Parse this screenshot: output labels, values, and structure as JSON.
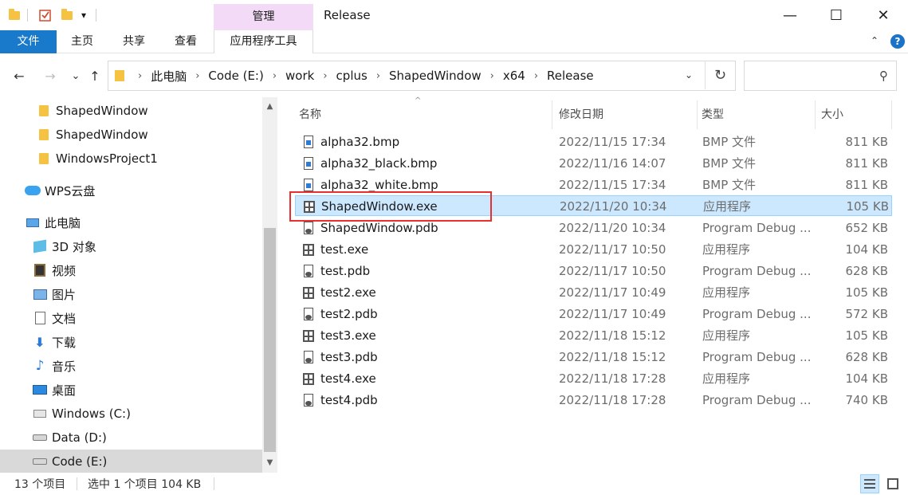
{
  "window": {
    "title": "Release",
    "contextual_tab_group": "管理",
    "controls": {
      "minimize": "—",
      "maximize": "☐",
      "close": "✕"
    }
  },
  "quick_access": {
    "dropdown": "▾"
  },
  "ribbon": {
    "tabs": [
      "文件",
      "主页",
      "共享",
      "查看",
      "应用程序工具"
    ],
    "collapse_chevron": "⌃",
    "help": "?"
  },
  "navigation": {
    "back": "←",
    "forward": "→",
    "recent": "⌄",
    "up": "↑",
    "breadcrumb": [
      "此电脑",
      "Code (E:)",
      "work",
      "cplus",
      "ShapedWindow",
      "x64",
      "Release"
    ],
    "chevron": "›",
    "address_dropdown": "⌄",
    "refresh": "↻",
    "search_placeholder": "",
    "search_icon": "⚲"
  },
  "nav_pane": {
    "items": [
      {
        "label": "ShapedWindow",
        "icon": "folder-icon"
      },
      {
        "label": "ShapedWindow",
        "icon": "folder-icon"
      },
      {
        "label": "WindowsProject1",
        "icon": "folder-icon"
      },
      {
        "label": "WPS云盘",
        "icon": "cloud-icon"
      },
      {
        "label": "此电脑",
        "icon": "computer-icon"
      },
      {
        "label": "3D 对象",
        "icon": "3d-objects-icon"
      },
      {
        "label": "视频",
        "icon": "video-icon"
      },
      {
        "label": "图片",
        "icon": "pictures-icon"
      },
      {
        "label": "文档",
        "icon": "documents-icon"
      },
      {
        "label": "下载",
        "icon": "download-icon"
      },
      {
        "label": "音乐",
        "icon": "music-icon"
      },
      {
        "label": "桌面",
        "icon": "desktop-icon"
      },
      {
        "label": "Windows (C:)",
        "icon": "windows-drive-icon"
      },
      {
        "label": "Data (D:)",
        "icon": "drive-icon"
      },
      {
        "label": "Code (E:)",
        "icon": "drive-icon",
        "selected": true
      }
    ],
    "scroll_up": "▲",
    "scroll_down": "▼"
  },
  "file_list": {
    "columns": {
      "name": "名称",
      "date": "修改日期",
      "type": "类型",
      "size": "大小"
    },
    "sort_indicator": "^",
    "rows": [
      {
        "name": "alpha32.bmp",
        "date": "2022/11/15 17:34",
        "type": "BMP 文件",
        "size": "811 KB",
        "kind": "bmp"
      },
      {
        "name": "alpha32_black.bmp",
        "date": "2022/11/16 14:07",
        "type": "BMP 文件",
        "size": "811 KB",
        "kind": "bmp"
      },
      {
        "name": "alpha32_white.bmp",
        "date": "2022/11/15 17:34",
        "type": "BMP 文件",
        "size": "811 KB",
        "kind": "bmp"
      },
      {
        "name": "ShapedWindow.exe",
        "date": "2022/11/20 10:34",
        "type": "应用程序",
        "size": "105 KB",
        "kind": "exe",
        "selected": true
      },
      {
        "name": "ShapedWindow.pdb",
        "date": "2022/11/20 10:34",
        "type": "Program Debug ...",
        "size": "652 KB",
        "kind": "pdb"
      },
      {
        "name": "test.exe",
        "date": "2022/11/17 10:50",
        "type": "应用程序",
        "size": "104 KB",
        "kind": "exe"
      },
      {
        "name": "test.pdb",
        "date": "2022/11/17 10:50",
        "type": "Program Debug ...",
        "size": "628 KB",
        "kind": "pdb"
      },
      {
        "name": "test2.exe",
        "date": "2022/11/17 10:49",
        "type": "应用程序",
        "size": "105 KB",
        "kind": "exe"
      },
      {
        "name": "test2.pdb",
        "date": "2022/11/17 10:49",
        "type": "Program Debug ...",
        "size": "572 KB",
        "kind": "pdb"
      },
      {
        "name": "test3.exe",
        "date": "2022/11/18 15:12",
        "type": "应用程序",
        "size": "105 KB",
        "kind": "exe"
      },
      {
        "name": "test3.pdb",
        "date": "2022/11/18 15:12",
        "type": "Program Debug ...",
        "size": "628 KB",
        "kind": "pdb"
      },
      {
        "name": "test4.exe",
        "date": "2022/11/18 17:28",
        "type": "应用程序",
        "size": "104 KB",
        "kind": "exe"
      },
      {
        "name": "test4.pdb",
        "date": "2022/11/18 17:28",
        "type": "Program Debug ...",
        "size": "740 KB",
        "kind": "pdb"
      }
    ]
  },
  "status_bar": {
    "item_count": "13 个项目",
    "selection": "选中 1 个项目  104 KB"
  },
  "colors": {
    "file_tab": "#1979ca",
    "context_tab": "#f3dbf7",
    "selection_bg": "#cce8ff",
    "selection_border": "#99d1ff",
    "annotation": "#e8312f"
  }
}
